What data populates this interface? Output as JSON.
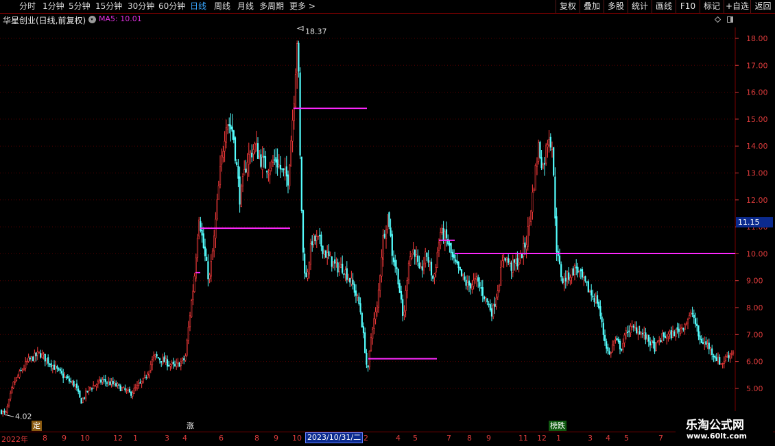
{
  "toolbar": {
    "periods": [
      "分时",
      "1分钟",
      "5分钟",
      "15分钟",
      "30分钟",
      "60分钟",
      "日线",
      "周线",
      "月线",
      "多周期",
      "更多 >"
    ],
    "active_period": "日线",
    "right_buttons": [
      "复权",
      "叠加",
      "多股",
      "统计",
      "画线",
      "F10",
      "标记",
      "+自选",
      "返回"
    ]
  },
  "header": {
    "title": "华星创业(日线,前复权)",
    "ma_label": "MA5: 10.01"
  },
  "colors": {
    "up": "#ff3c3c",
    "down": "#54ffff",
    "ma": "#ff28ff",
    "axis": "#e03c3c",
    "grid": "#5a0000",
    "badge": "#0b2a8e"
  },
  "price_badge": "11.15",
  "high_label": "18.37",
  "low_label": "4.02",
  "date_badge": "2023/10/31/二",
  "markers": [
    {
      "text": "定",
      "bg": "#8a5a10",
      "color": "#fff"
    },
    {
      "text": "涨",
      "bg": "#000",
      "color": "#fff"
    },
    {
      "text": "榜跌",
      "bg": "#0f5a10",
      "color": "#fff"
    }
  ],
  "months": [
    "2022年",
    "8",
    "9",
    "10",
    "12",
    "1",
    "3",
    "4",
    "6",
    "8",
    "9",
    "10",
    "2",
    "4",
    "5",
    "7",
    "8",
    "9",
    "11",
    "12",
    "1",
    "3",
    "4",
    "5",
    "7"
  ],
  "watermark": {
    "title": "乐淘公式网",
    "url": "www.60lt.com"
  },
  "chart_data": {
    "type": "candlestick",
    "title": "华星创业(日线,前复权)",
    "ylim": [
      4.5,
      18.5
    ],
    "yticks": [
      "18.00",
      "17.00",
      "16.00",
      "15.00",
      "14.00",
      "13.00",
      "12.00",
      "11.00",
      "10.00",
      "9.00",
      "8.00",
      "7.00",
      "6.00",
      "5.00"
    ],
    "x_categories": [
      "2022年",
      "8",
      "9",
      "10",
      "12",
      "1",
      "3",
      "4",
      "6",
      "8",
      "9",
      "10",
      "2",
      "4",
      "5",
      "7",
      "8",
      "9",
      "11",
      "12",
      "1",
      "3",
      "4",
      "5",
      "7"
    ],
    "price_path": [
      [
        0,
        4.2
      ],
      [
        8,
        4.02
      ],
      [
        20,
        5.2
      ],
      [
        40,
        6.0
      ],
      [
        58,
        6.3
      ],
      [
        75,
        5.9
      ],
      [
        90,
        5.5
      ],
      [
        110,
        5.1
      ],
      [
        118,
        4.5
      ],
      [
        130,
        5.0
      ],
      [
        150,
        5.3
      ],
      [
        170,
        5.1
      ],
      [
        190,
        4.8
      ],
      [
        210,
        5.3
      ],
      [
        225,
        6.2
      ],
      [
        240,
        6.0
      ],
      [
        255,
        5.8
      ],
      [
        270,
        6.1
      ],
      [
        278,
        8.0
      ],
      [
        283,
        9.0
      ],
      [
        290,
        11.5
      ],
      [
        298,
        10.0
      ],
      [
        305,
        9.0
      ],
      [
        312,
        10.5
      ],
      [
        320,
        12.8
      ],
      [
        330,
        15.0
      ],
      [
        340,
        14.5
      ],
      [
        350,
        12.0
      ],
      [
        360,
        13.5
      ],
      [
        372,
        14.0
      ],
      [
        382,
        13.4
      ],
      [
        392,
        13.2
      ],
      [
        402,
        13.5
      ],
      [
        412,
        13.0
      ],
      [
        420,
        12.8
      ],
      [
        428,
        15.5
      ],
      [
        434,
        18.37
      ],
      [
        438,
        13.0
      ],
      [
        442,
        10.0
      ],
      [
        446,
        9.0
      ],
      [
        455,
        10.5
      ],
      [
        465,
        10.5
      ],
      [
        475,
        10.0
      ],
      [
        490,
        9.5
      ],
      [
        500,
        9.5
      ],
      [
        515,
        8.8
      ],
      [
        525,
        8.0
      ],
      [
        532,
        6.5
      ],
      [
        536,
        5.5
      ],
      [
        542,
        7.2
      ],
      [
        550,
        8.0
      ],
      [
        558,
        10.5
      ],
      [
        566,
        11.5
      ],
      [
        572,
        10.0
      ],
      [
        580,
        9.2
      ],
      [
        588,
        7.5
      ],
      [
        596,
        9.8
      ],
      [
        604,
        10.2
      ],
      [
        612,
        9.2
      ],
      [
        622,
        10.0
      ],
      [
        632,
        9.0
      ],
      [
        642,
        10.8
      ],
      [
        652,
        10.5
      ],
      [
        660,
        9.8
      ],
      [
        672,
        9.2
      ],
      [
        682,
        8.8
      ],
      [
        695,
        9.0
      ],
      [
        705,
        8.5
      ],
      [
        718,
        7.8
      ],
      [
        728,
        9.0
      ],
      [
        735,
        10.0
      ],
      [
        745,
        9.5
      ],
      [
        758,
        9.8
      ],
      [
        768,
        10.5
      ],
      [
        778,
        12.5
      ],
      [
        785,
        14.0
      ],
      [
        792,
        13.2
      ],
      [
        800,
        14.5
      ],
      [
        805,
        14.0
      ],
      [
        812,
        10.0
      ],
      [
        820,
        9.0
      ],
      [
        830,
        9.2
      ],
      [
        840,
        9.5
      ],
      [
        850,
        9.0
      ],
      [
        862,
        8.5
      ],
      [
        872,
        8.2
      ],
      [
        880,
        7.0
      ],
      [
        888,
        6.2
      ],
      [
        896,
        6.8
      ],
      [
        906,
        6.5
      ],
      [
        915,
        7.2
      ],
      [
        930,
        7.2
      ],
      [
        945,
        6.8
      ],
      [
        955,
        6.5
      ],
      [
        965,
        6.9
      ],
      [
        980,
        7.0
      ],
      [
        995,
        7.3
      ],
      [
        1010,
        7.8
      ],
      [
        1020,
        6.8
      ],
      [
        1032,
        6.6
      ],
      [
        1042,
        6.2
      ],
      [
        1052,
        5.9
      ],
      [
        1060,
        6.2
      ],
      [
        1070,
        6.4
      ]
    ],
    "support_lines": [
      {
        "y": 9.3,
        "x_range": [
          285,
          292
        ]
      },
      {
        "y": 10.95,
        "x_range": [
          292,
          423
        ]
      },
      {
        "y": 15.4,
        "x_range": [
          428,
          535
        ]
      },
      {
        "y": 6.1,
        "x_range": [
          537,
          637
        ]
      },
      {
        "y": 10.5,
        "x_range": [
          640,
          663
        ]
      },
      {
        "y": 10.01,
        "x_range": [
          663,
          1072
        ]
      }
    ],
    "high": 18.37,
    "low": 4.02,
    "last": 11.15,
    "ma5": 10.01
  }
}
